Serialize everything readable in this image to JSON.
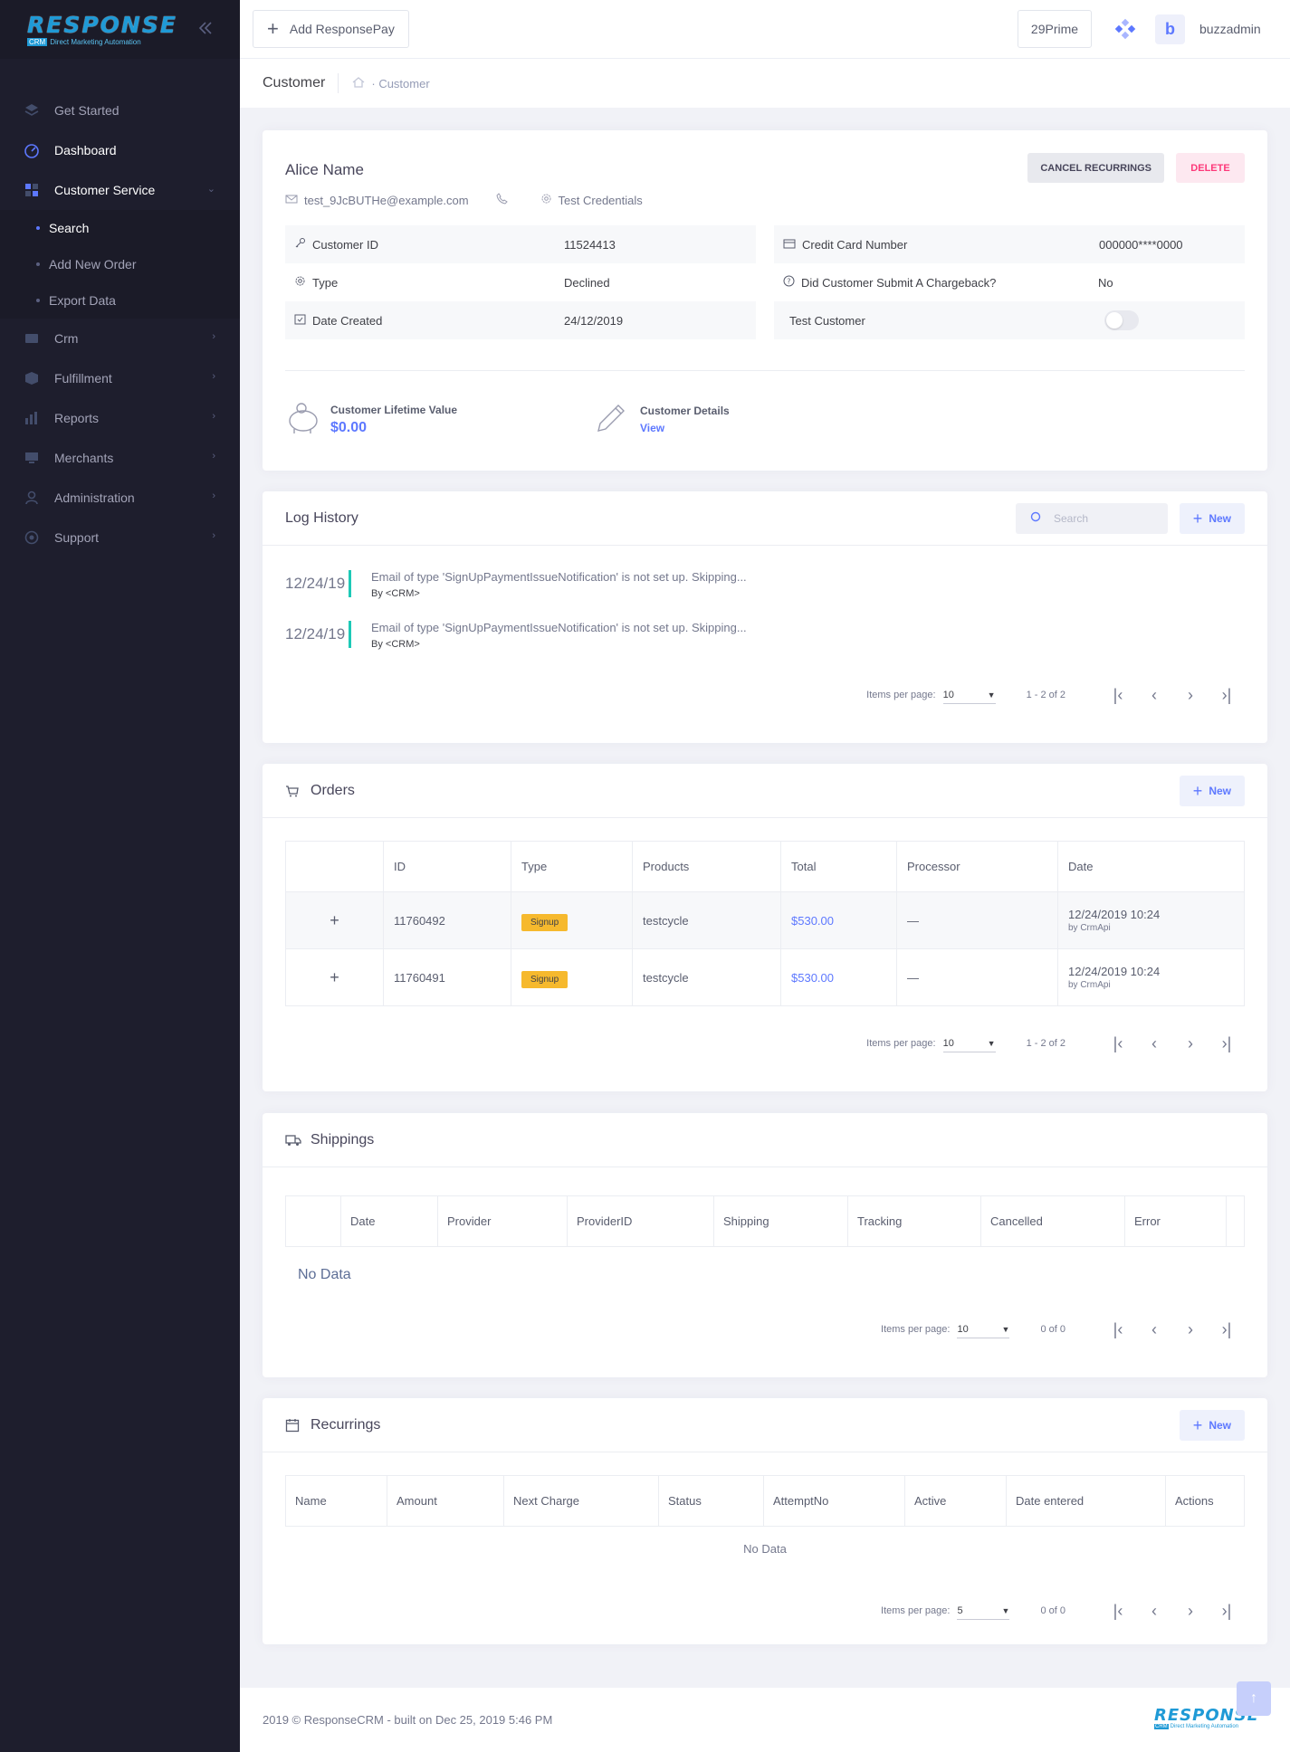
{
  "brand": {
    "logo_word": "RESPONSE",
    "logo_crm": "CRM",
    "logo_sub": "Direct Marketing Automation"
  },
  "sidebar": {
    "items": [
      {
        "label": "Get Started"
      },
      {
        "label": "Dashboard"
      },
      {
        "label": "Customer Service"
      }
    ],
    "sub_items": [
      {
        "label": "Search"
      },
      {
        "label": "Add New Order"
      },
      {
        "label": "Export Data"
      }
    ],
    "items_after": [
      {
        "label": "Crm"
      },
      {
        "label": "Fulfillment"
      },
      {
        "label": "Reports"
      },
      {
        "label": "Merchants"
      },
      {
        "label": "Administration"
      },
      {
        "label": "Support"
      }
    ]
  },
  "header": {
    "add_label": "Add ResponsePay",
    "prime_label": "29Prime",
    "avatar_letter": "b",
    "username": "buzzadmin"
  },
  "subheader": {
    "title": "Customer",
    "crumb": "Customer"
  },
  "customer": {
    "name": "Alice Name",
    "email": "test_9JcBUTHe@example.com",
    "credentials": "Test Credentials",
    "cancel_label": "CANCEL RECURRINGS",
    "delete_label": "DELETE",
    "fields_left": [
      {
        "label": "Customer ID",
        "value": "11524413"
      },
      {
        "label": "Type",
        "value": "Declined"
      },
      {
        "label": "Date Created",
        "value": "24/12/2019"
      }
    ],
    "fields_right": [
      {
        "label": "Credit Card Number",
        "value": "000000****0000"
      },
      {
        "label": "Did Customer Submit A Chargeback?",
        "value": "No"
      },
      {
        "label": "Test Customer",
        "value": ""
      }
    ],
    "ltv_label": "Customer Lifetime Value",
    "ltv_value": "$0.00",
    "details_label": "Customer Details",
    "details_link": "View"
  },
  "log": {
    "title": "Log History",
    "search_placeholder": "Search",
    "new_label": "New",
    "entries": [
      {
        "date": "12/24/19",
        "text": "Email of type 'SignUpPaymentIssueNotification' is not set up. Skipping...",
        "by": "By <CRM>"
      },
      {
        "date": "12/24/19",
        "text": "Email of type 'SignUpPaymentIssueNotification' is not set up. Skipping...",
        "by": "By <CRM>"
      }
    ],
    "pager": {
      "label": "Items per page:",
      "size": "10",
      "range": "1 - 2 of 2"
    }
  },
  "orders": {
    "title": "Orders",
    "new_label": "New",
    "columns": [
      "",
      "ID",
      "Type",
      "Products",
      "Total",
      "Processor",
      "Date"
    ],
    "rows": [
      {
        "expand": "+",
        "id": "11760492",
        "type": "Signup",
        "products": "testcycle",
        "total": "$530.00",
        "processor": "—",
        "date": "12/24/2019 10:24",
        "by": "by CrmApi"
      },
      {
        "expand": "+",
        "id": "11760491",
        "type": "Signup",
        "products": "testcycle",
        "total": "$530.00",
        "processor": "—",
        "date": "12/24/2019 10:24",
        "by": "by CrmApi"
      }
    ],
    "pager": {
      "label": "Items per page:",
      "size": "10",
      "range": "1 - 2 of 2"
    }
  },
  "shippings": {
    "title": "Shippings",
    "columns": [
      "",
      "Date",
      "Provider",
      "ProviderID",
      "Shipping",
      "Tracking",
      "Cancelled",
      "Error",
      ""
    ],
    "empty": "No Data",
    "pager": {
      "label": "Items per page:",
      "size": "10",
      "range": "0 of 0"
    }
  },
  "recurrings": {
    "title": "Recurrings",
    "new_label": "New",
    "columns": [
      "Name",
      "Amount",
      "Next Charge",
      "Status",
      "AttemptNo",
      "Active",
      "Date entered",
      "Actions"
    ],
    "empty": "No Data",
    "pager": {
      "label": "Items per page:",
      "size": "5",
      "range": "0 of 0"
    }
  },
  "footer": {
    "text": "2019 © ResponseCRM - built on Dec 25, 2019 5:46 PM",
    "scrolltop": "↑"
  },
  "colors": {
    "accent": "#5d78ff",
    "sidebar": "#1e1e2d",
    "badge": "#f6b92d",
    "log_bar": "#1dc9b7",
    "delete_text": "#fd397a"
  }
}
